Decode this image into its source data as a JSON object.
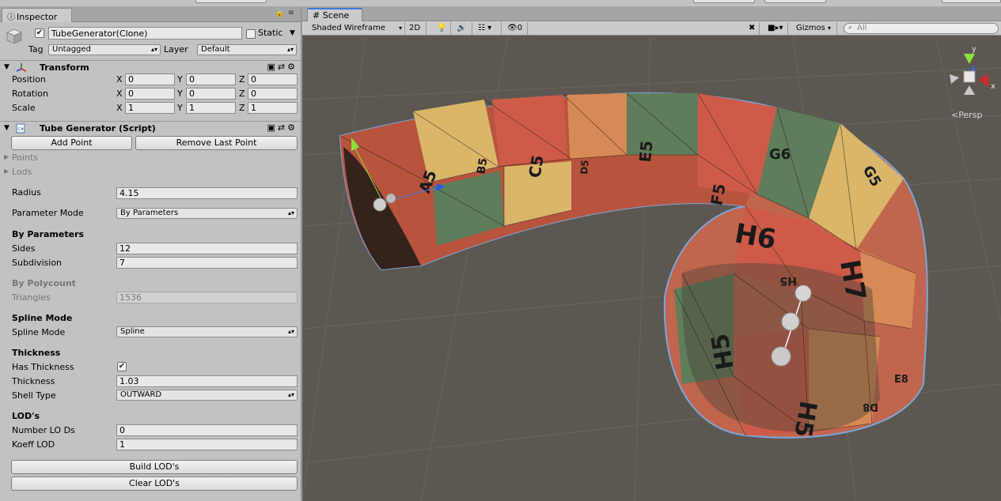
{
  "inspector": {
    "tab_label": "Inspector",
    "object_name": "TubeGenerator(Clone)",
    "static_label": "Static",
    "tag_label": "Tag",
    "tag_value": "Untagged",
    "layer_label": "Layer",
    "layer_value": "Default",
    "transform": {
      "title": "Transform",
      "position_label": "Position",
      "rotation_label": "Rotation",
      "scale_label": "Scale",
      "axis_x": "X",
      "axis_y": "Y",
      "axis_z": "Z",
      "position": [
        "0",
        "0",
        "0"
      ],
      "rotation": [
        "0",
        "0",
        "0"
      ],
      "scale": [
        "1",
        "1",
        "1"
      ]
    },
    "script": {
      "title": "Tube Generator (Script)",
      "add_point": "Add Point",
      "remove_last_point": "Remove Last Point",
      "points_label": "Points",
      "lods_label": "Lods",
      "radius_label": "Radius",
      "radius_value": "4.15",
      "parameter_mode_label": "Parameter Mode",
      "parameter_mode_value": "By Parameters",
      "by_parameters_header": "By Parameters",
      "sides_label": "Sides",
      "sides_value": "12",
      "subdivision_label": "Subdivision",
      "subdivision_value": "7",
      "by_polycount_header": "By Polycount",
      "triangles_label": "Triangles",
      "triangles_value": "1536",
      "spline_mode_header": "Spline Mode",
      "spline_mode_label": "Spline Mode",
      "spline_mode_value": "Spline",
      "thickness_header": "Thickness",
      "has_thickness_label": "Has Thickness",
      "thickness_label": "Thickness",
      "thickness_value": "1.03",
      "shell_type_label": "Shell Type",
      "shell_type_value": "OUTWARD",
      "lods_header": "LOD's",
      "number_lods_label": "Number LO Ds",
      "number_lods_value": "0",
      "koeff_lod_label": "Koeff LOD",
      "koeff_lod_value": "1",
      "build_lods": "Build LOD's",
      "clear_lods": "Clear LOD's"
    }
  },
  "scene": {
    "tab_label": "Scene",
    "shading_mode": "Shaded Wireframe",
    "mode_2d": "2D",
    "hidden_count": "0",
    "gizmos_label": "Gizmos",
    "search_placeholder": "All",
    "projection_label": "Persp",
    "gizmo_axes": {
      "x": "x",
      "y": "y"
    }
  },
  "tube_labels": [
    "A5",
    "B5",
    "C5",
    "D5",
    "E5",
    "F5",
    "G6",
    "G5",
    "H6",
    "H7",
    "H5",
    "E8",
    "D8"
  ],
  "colors": {
    "tile_red": "#cd5b48",
    "tile_green": "#5e7d5a",
    "tile_yellow": "#d9b66a",
    "tile_orange": "#d68a55",
    "selection_outline": "#7ba6d8",
    "scene_background": "#5d5752"
  }
}
